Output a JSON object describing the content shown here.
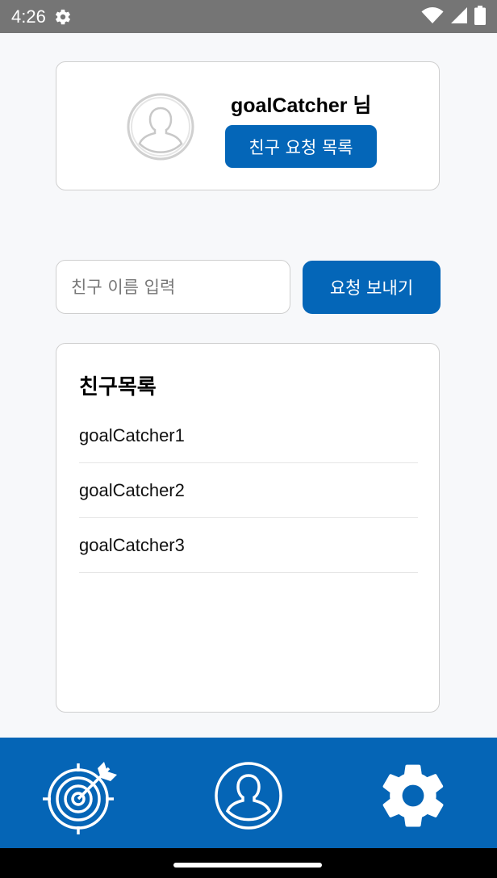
{
  "status_bar": {
    "time": "4:26",
    "icons": [
      "settings-gear-icon",
      "wifi-icon",
      "signal-icon",
      "battery-icon"
    ]
  },
  "profile": {
    "username": "goalCatcher 님",
    "avatar_icon": "user-silhouette-icon",
    "request_list_button": "친구 요청 목록"
  },
  "add_friend": {
    "input_placeholder": "친구 이름 입력",
    "input_value": "",
    "send_button": "요청 보내기"
  },
  "friends": {
    "title": "친구목록",
    "items": [
      "goalCatcher1",
      "goalCatcher2",
      "goalCatcher3"
    ]
  },
  "bottom_nav": {
    "items": [
      {
        "icon": "target-arrow-icon"
      },
      {
        "icon": "profile-icon"
      },
      {
        "icon": "settings-gear-icon"
      }
    ]
  },
  "colors": {
    "primary": "#0466b8",
    "status_bar": "#757575",
    "background": "#f7f8fa"
  }
}
